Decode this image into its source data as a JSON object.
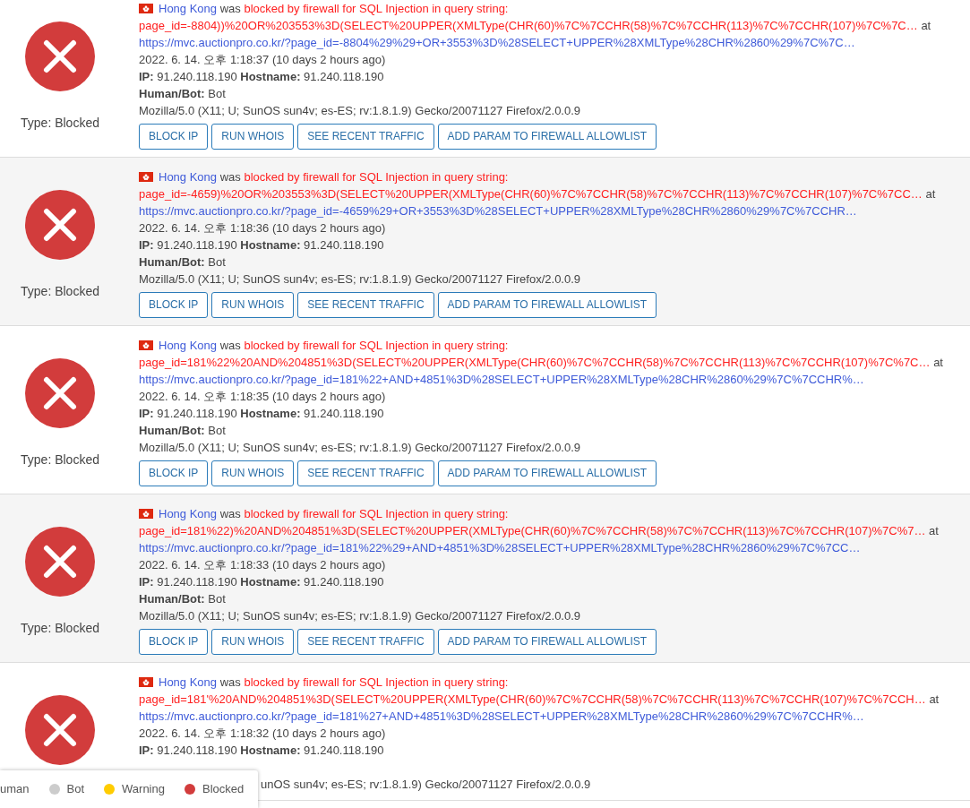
{
  "rows": [
    {
      "country": "Hong Kong",
      "verb": "was",
      "reason": "blocked by firewall for SQL Injection in query string:",
      "query": "page_id=-8804))%20OR%203553%3D(SELECT%20UPPER(XMLType(CHR(60)%7C%7CCHR(58)%7C%7CCHR(113)%7C%7CCHR(107)%7C%7C…",
      "at": "at",
      "url": "https://mvc.auctionpro.co.kr/?page_id=-8804%29%29+OR+3553%3D%28SELECT+UPPER%28XMLType%28CHR%2860%29%7C%7C…",
      "time": "2022. 6. 14. 오후 1:18:37 (10 days 2 hours ago)",
      "ip_label": "IP:",
      "ip": "91.240.118.190",
      "hostname_label": "Hostname:",
      "hostname": "91.240.118.190",
      "human_bot_label": "Human/Bot:",
      "human_bot": "Bot",
      "user_agent": "Mozilla/5.0 (X11; U; SunOS sun4v; es-ES; rv:1.8.1.9) Gecko/20071127 Firefox/2.0.0.9",
      "covered": false,
      "type": "Type: Blocked",
      "buttons": [
        "BLOCK IP",
        "RUN WHOIS",
        "SEE RECENT TRAFFIC",
        "ADD PARAM TO FIREWALL ALLOWLIST"
      ]
    },
    {
      "country": "Hong Kong",
      "verb": "was",
      "reason": "blocked by firewall for SQL Injection in query string:",
      "query": "page_id=-4659)%20OR%203553%3D(SELECT%20UPPER(XMLType(CHR(60)%7C%7CCHR(58)%7C%7CCHR(113)%7C%7CCHR(107)%7C%7CC…",
      "at": "at",
      "url": "https://mvc.auctionpro.co.kr/?page_id=-4659%29+OR+3553%3D%28SELECT+UPPER%28XMLType%28CHR%2860%29%7C%7CCHR…",
      "time": "2022. 6. 14. 오후 1:18:36 (10 days 2 hours ago)",
      "ip_label": "IP:",
      "ip": "91.240.118.190",
      "hostname_label": "Hostname:",
      "hostname": "91.240.118.190",
      "human_bot_label": "Human/Bot:",
      "human_bot": "Bot",
      "user_agent": "Mozilla/5.0 (X11; U; SunOS sun4v; es-ES; rv:1.8.1.9) Gecko/20071127 Firefox/2.0.0.9",
      "covered": false,
      "type": "Type: Blocked",
      "buttons": [
        "BLOCK IP",
        "RUN WHOIS",
        "SEE RECENT TRAFFIC",
        "ADD PARAM TO FIREWALL ALLOWLIST"
      ]
    },
    {
      "country": "Hong Kong",
      "verb": "was",
      "reason": "blocked by firewall for SQL Injection in query string:",
      "query": "page_id=181%22%20AND%204851%3D(SELECT%20UPPER(XMLType(CHR(60)%7C%7CCHR(58)%7C%7CCHR(113)%7C%7CCHR(107)%7C%7C…",
      "at": "at",
      "url": "https://mvc.auctionpro.co.kr/?page_id=181%22+AND+4851%3D%28SELECT+UPPER%28XMLType%28CHR%2860%29%7C%7CCHR%…",
      "time": "2022. 6. 14. 오후 1:18:35 (10 days 2 hours ago)",
      "ip_label": "IP:",
      "ip": "91.240.118.190",
      "hostname_label": "Hostname:",
      "hostname": "91.240.118.190",
      "human_bot_label": "Human/Bot:",
      "human_bot": "Bot",
      "user_agent": "Mozilla/5.0 (X11; U; SunOS sun4v; es-ES; rv:1.8.1.9) Gecko/20071127 Firefox/2.0.0.9",
      "covered": false,
      "type": "Type: Blocked",
      "buttons": [
        "BLOCK IP",
        "RUN WHOIS",
        "SEE RECENT TRAFFIC",
        "ADD PARAM TO FIREWALL ALLOWLIST"
      ]
    },
    {
      "country": "Hong Kong",
      "verb": "was",
      "reason": "blocked by firewall for SQL Injection in query string:",
      "query": "page_id=181%22)%20AND%204851%3D(SELECT%20UPPER(XMLType(CHR(60)%7C%7CCHR(58)%7C%7CCHR(113)%7C%7CCHR(107)%7C%7…",
      "at": "at",
      "url": "https://mvc.auctionpro.co.kr/?page_id=181%22%29+AND+4851%3D%28SELECT+UPPER%28XMLType%28CHR%2860%29%7C%7CC…",
      "time": "2022. 6. 14. 오후 1:18:33 (10 days 2 hours ago)",
      "ip_label": "IP:",
      "ip": "91.240.118.190",
      "hostname_label": "Hostname:",
      "hostname": "91.240.118.190",
      "human_bot_label": "Human/Bot:",
      "human_bot": "Bot",
      "user_agent": "Mozilla/5.0 (X11; U; SunOS sun4v; es-ES; rv:1.8.1.9) Gecko/20071127 Firefox/2.0.0.9",
      "covered": false,
      "type": "Type: Blocked",
      "buttons": [
        "BLOCK IP",
        "RUN WHOIS",
        "SEE RECENT TRAFFIC",
        "ADD PARAM TO FIREWALL ALLOWLIST"
      ]
    },
    {
      "country": "Hong Kong",
      "verb": "was",
      "reason": "blocked by firewall for SQL Injection in query string:",
      "query": "page_id=181'%20AND%204851%3D(SELECT%20UPPER(XMLType(CHR(60)%7C%7CCHR(58)%7C%7CCHR(113)%7C%7CCHR(107)%7C%7CCH…",
      "at": "at",
      "url": "https://mvc.auctionpro.co.kr/?page_id=181%27+AND+4851%3D%28SELECT+UPPER%28XMLType%28CHR%2860%29%7C%7CCHR%…",
      "time": "2022. 6. 14. 오후 1:18:32 (10 days 2 hours ago)",
      "ip_label": "IP:",
      "ip": "91.240.118.190",
      "hostname_label": "Hostname:",
      "hostname": "91.240.118.190",
      "user_agent": "unOS sun4v; es-ES; rv:1.8.1.9) Gecko/20071127 Firefox/2.0.0.9",
      "covered": true
    }
  ],
  "legend": [
    {
      "label": "uman"
    },
    {
      "label": "Bot",
      "color": "#cccccc"
    },
    {
      "label": "Warning",
      "color": "#ffcc00"
    },
    {
      "label": "Blocked",
      "color": "#d23c3c"
    }
  ]
}
